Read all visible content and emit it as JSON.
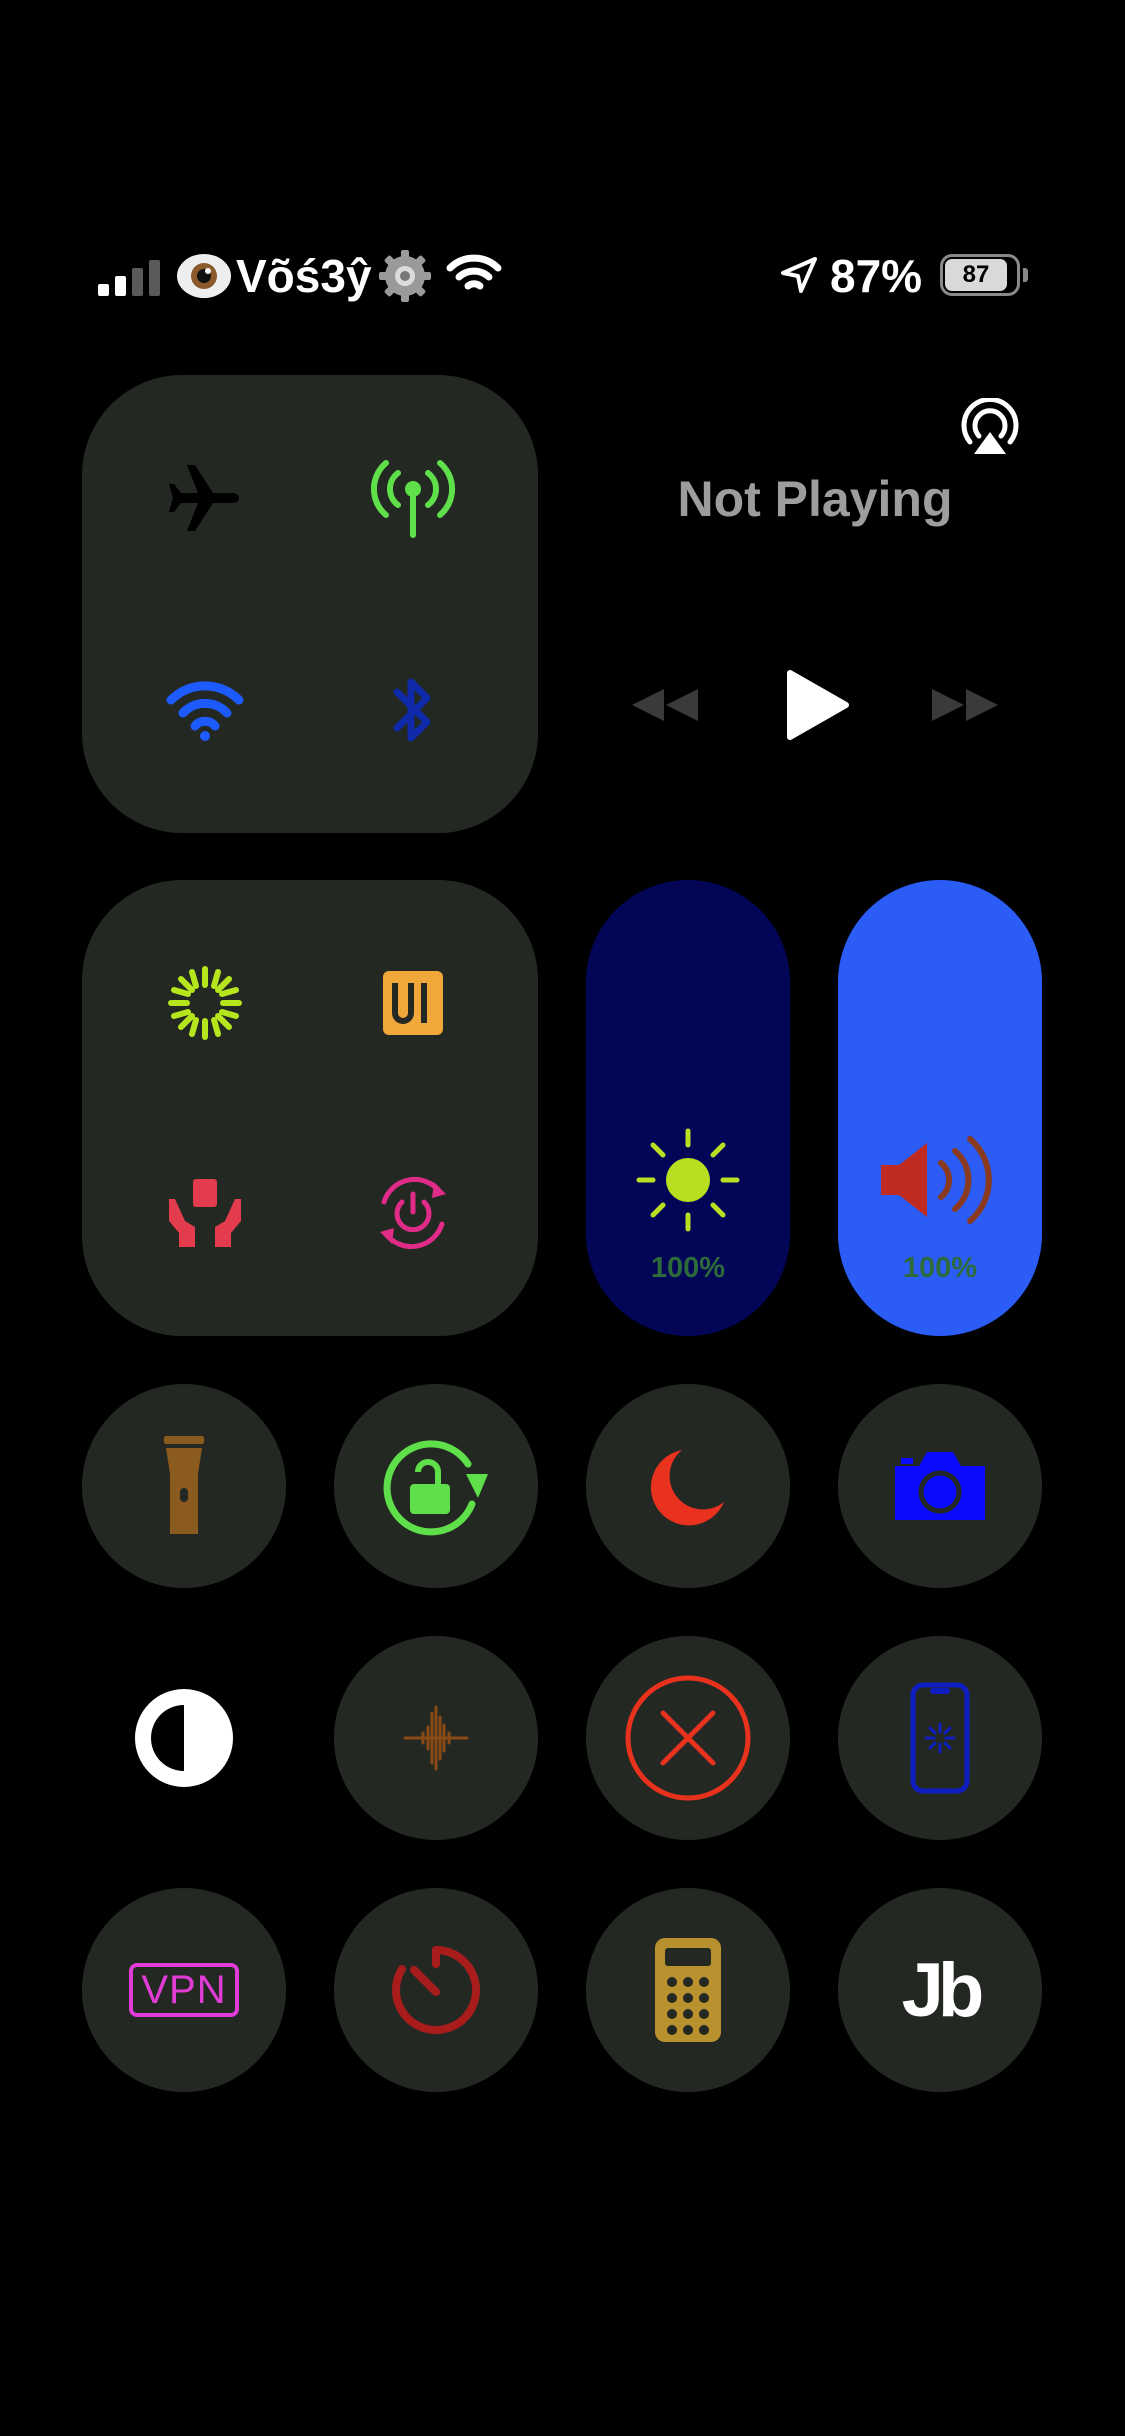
{
  "status_bar": {
    "carrier": "Võś3ŷ",
    "battery_percent": "87%",
    "battery_level": "87"
  },
  "media": {
    "title": "Not Playing"
  },
  "sliders": {
    "brightness_value": "100%",
    "volume_value": "100%"
  },
  "tiles": {
    "vpn_label": "VPN",
    "jb_label": "Jb"
  },
  "colors": {
    "panel": "#242823",
    "cellular": "#5fe04a",
    "wifi": "#1e5bff",
    "bluetooth": "#0e2aa8",
    "brightness_bg": "#030657",
    "volume_bg": "#2b5cf5"
  }
}
